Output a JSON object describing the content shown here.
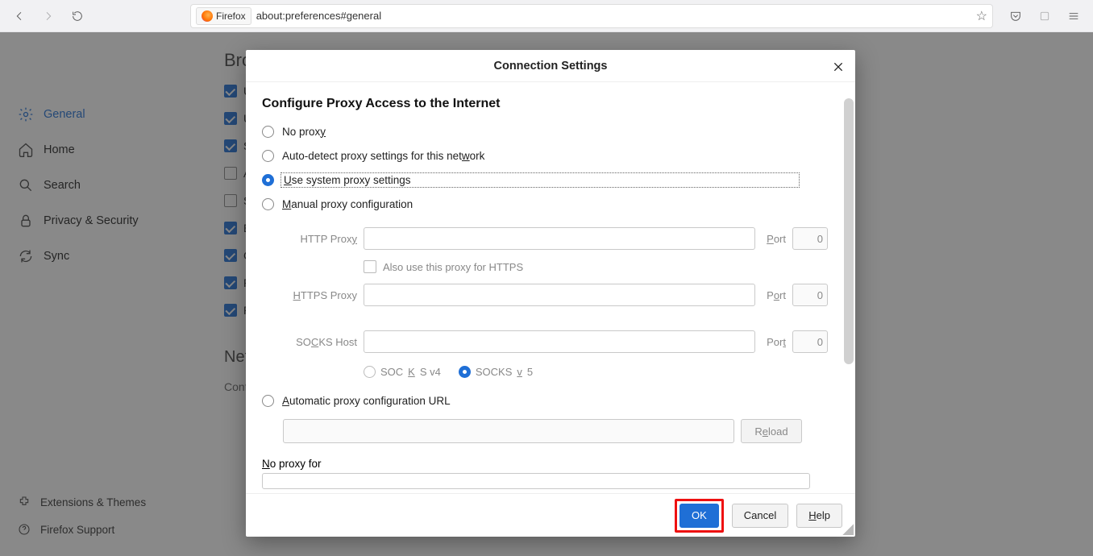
{
  "browser": {
    "chip_label": "Firefox",
    "url": "about:preferences#general"
  },
  "sidebar": {
    "items": [
      {
        "label": "General"
      },
      {
        "label": "Home"
      },
      {
        "label": "Search"
      },
      {
        "label": "Privacy & Security"
      },
      {
        "label": "Sync"
      }
    ],
    "footer": [
      {
        "label": "Extensions & Themes"
      },
      {
        "label": "Firefox Support"
      }
    ]
  },
  "content": {
    "section_heading_truncated": "Brow",
    "checks": [
      {
        "label": "Us",
        "checked": true
      },
      {
        "label": "Us",
        "checked": true
      },
      {
        "label": "Sh",
        "checked": true
      },
      {
        "label": "Al",
        "checked": false
      },
      {
        "label": "Se",
        "checked": false
      },
      {
        "label": "En",
        "checked": true
      },
      {
        "label": "Co",
        "checked": true
      },
      {
        "label": "Re",
        "checked": true
      },
      {
        "label": "Re",
        "checked": true
      }
    ],
    "network_heading_truncated": "Netw",
    "network_sub_truncated": "Config"
  },
  "dialog": {
    "title": "Connection Settings",
    "heading": "Configure Proxy Access to the Internet",
    "radios": {
      "no_proxy": "No proxy",
      "auto_detect": "Auto-detect proxy settings for this network",
      "use_system": "Use system proxy settings",
      "manual": "Manual proxy configuration",
      "automatic_url": "Automatic proxy configuration URL",
      "selected": "use_system"
    },
    "proxy": {
      "http_label": "HTTP Proxy",
      "https_label": "HTTPS Proxy",
      "socks_label": "SOCKS Host",
      "port_label": "Port",
      "http_value": "",
      "http_port": "0",
      "also_https": "Also use this proxy for HTTPS",
      "https_value": "",
      "https_port": "0",
      "socks_value": "",
      "socks_port": "0",
      "socks_v4": "SOCKS v4",
      "socks_v5": "SOCKS v5",
      "socks_selected": "v5"
    },
    "auto_url_value": "",
    "reload_label": "Reload",
    "no_proxy_for_label": "No proxy for",
    "no_proxy_for_value": "",
    "buttons": {
      "ok": "OK",
      "cancel": "Cancel",
      "help": "Help"
    }
  }
}
